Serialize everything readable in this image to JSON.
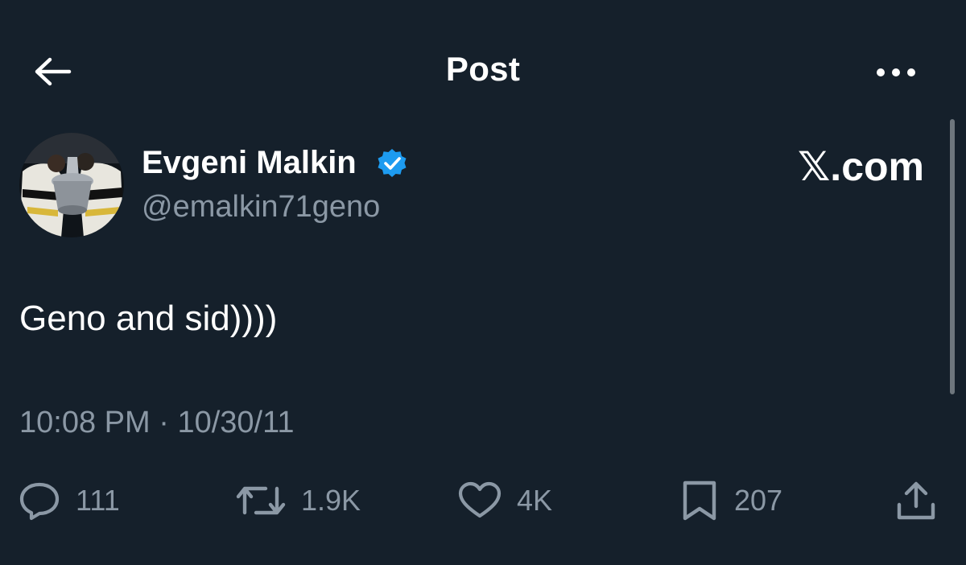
{
  "header": {
    "title": "Post",
    "back_icon": "arrow-left-icon",
    "more_icon": "more-horizontal-icon"
  },
  "author": {
    "display_name": "Evgeni Malkin",
    "handle": "@emalkin71geno",
    "verified": true,
    "verified_color": "#1d9bf0"
  },
  "watermark": {
    "x_glyph": "𝕏",
    "domain": ".com"
  },
  "post": {
    "text": "Geno and sid))))",
    "time": "10:08 PM",
    "separator": "·",
    "date": "10/30/11"
  },
  "actions": {
    "reply": {
      "icon": "reply-icon",
      "count": "111"
    },
    "repost": {
      "icon": "repost-icon",
      "count": "1.9K"
    },
    "like": {
      "icon": "heart-icon",
      "count": "4K"
    },
    "bookmark": {
      "icon": "bookmark-icon",
      "count": "207"
    },
    "share": {
      "icon": "share-icon"
    }
  },
  "colors": {
    "background": "#15202b",
    "primary_text": "#ffffff",
    "secondary_text": "#8b98a5"
  }
}
